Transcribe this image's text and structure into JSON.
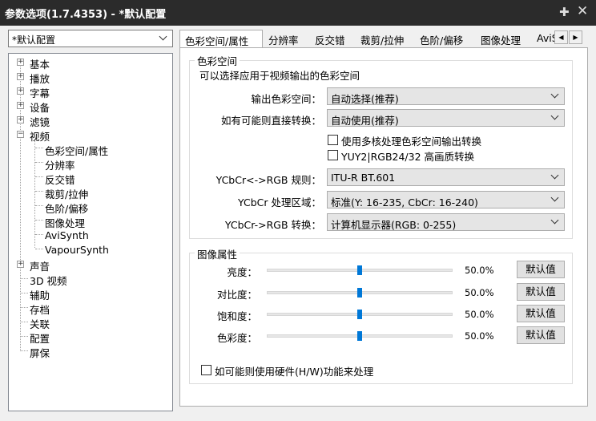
{
  "window": {
    "title": "参数选项(1.7.4353) - *默认配置",
    "pin_icon": "pin-icon",
    "close_icon": "close-icon"
  },
  "profile": {
    "value": "*默认配置"
  },
  "tree": {
    "items": [
      {
        "label": "基本",
        "expandable": true
      },
      {
        "label": "播放",
        "expandable": true
      },
      {
        "label": "字幕",
        "expandable": true
      },
      {
        "label": "设备",
        "expandable": true
      },
      {
        "label": "滤镜",
        "expandable": true
      },
      {
        "label": "视频",
        "expandable": true,
        "expanded": true
      },
      {
        "label": "色彩空间/属性",
        "child": true,
        "selected": true
      },
      {
        "label": "分辨率",
        "child": true
      },
      {
        "label": "反交错",
        "child": true
      },
      {
        "label": "裁剪/拉伸",
        "child": true
      },
      {
        "label": "色阶/偏移",
        "child": true
      },
      {
        "label": "图像处理",
        "child": true
      },
      {
        "label": "AviSynth",
        "child": true
      },
      {
        "label": "VapourSynth",
        "child": true
      },
      {
        "label": "声音",
        "expandable": true
      },
      {
        "label": "3D 视频"
      },
      {
        "label": "辅助"
      },
      {
        "label": "存档"
      },
      {
        "label": "关联"
      },
      {
        "label": "配置"
      },
      {
        "label": "屏保"
      }
    ]
  },
  "tabs": [
    "色彩空间/属性",
    "分辨率",
    "反交错",
    "裁剪/拉伸",
    "色阶/偏移",
    "图像处理",
    "AviS"
  ],
  "colorspace": {
    "title": "色彩空间",
    "desc": "可以选择应用于视频输出的色彩空间",
    "output_label": "输出色彩空间：",
    "output_value": "自动选择(推荐)",
    "direct_label": "如有可能则直接转换：",
    "direct_value": "自动使用(推荐)",
    "multicore_label": "使用多核处理色彩空间输出转换",
    "yuy2_label": "YUY2|RGB24/32 高画质转换",
    "ycbcr_rule_label": "YCbCr<->RGB 规则：",
    "ycbcr_rule_value": "ITU-R BT.601",
    "ycbcr_range_label": "YCbCr 处理区域：",
    "ycbcr_range_value": "标准(Y: 16-235, CbCr: 16-240)",
    "ycbcr_conv_label": "YCbCr->RGB 转换：",
    "ycbcr_conv_value": "计算机显示器(RGB: 0-255)"
  },
  "image_props": {
    "title": "图像属性",
    "default_label": "默认值",
    "sliders": [
      {
        "label": "亮度：",
        "value": "50.0%",
        "fraction": 0.5
      },
      {
        "label": "对比度：",
        "value": "50.0%",
        "fraction": 0.5
      },
      {
        "label": "饱和度：",
        "value": "50.0%",
        "fraction": 0.5
      },
      {
        "label": "色彩度：",
        "value": "50.0%",
        "fraction": 0.5
      }
    ],
    "hw_label": "如可能则使用硬件(H/W)功能来处理"
  },
  "colors": {
    "accent": "#0078d7",
    "titlebar": "#2b2b2b"
  }
}
